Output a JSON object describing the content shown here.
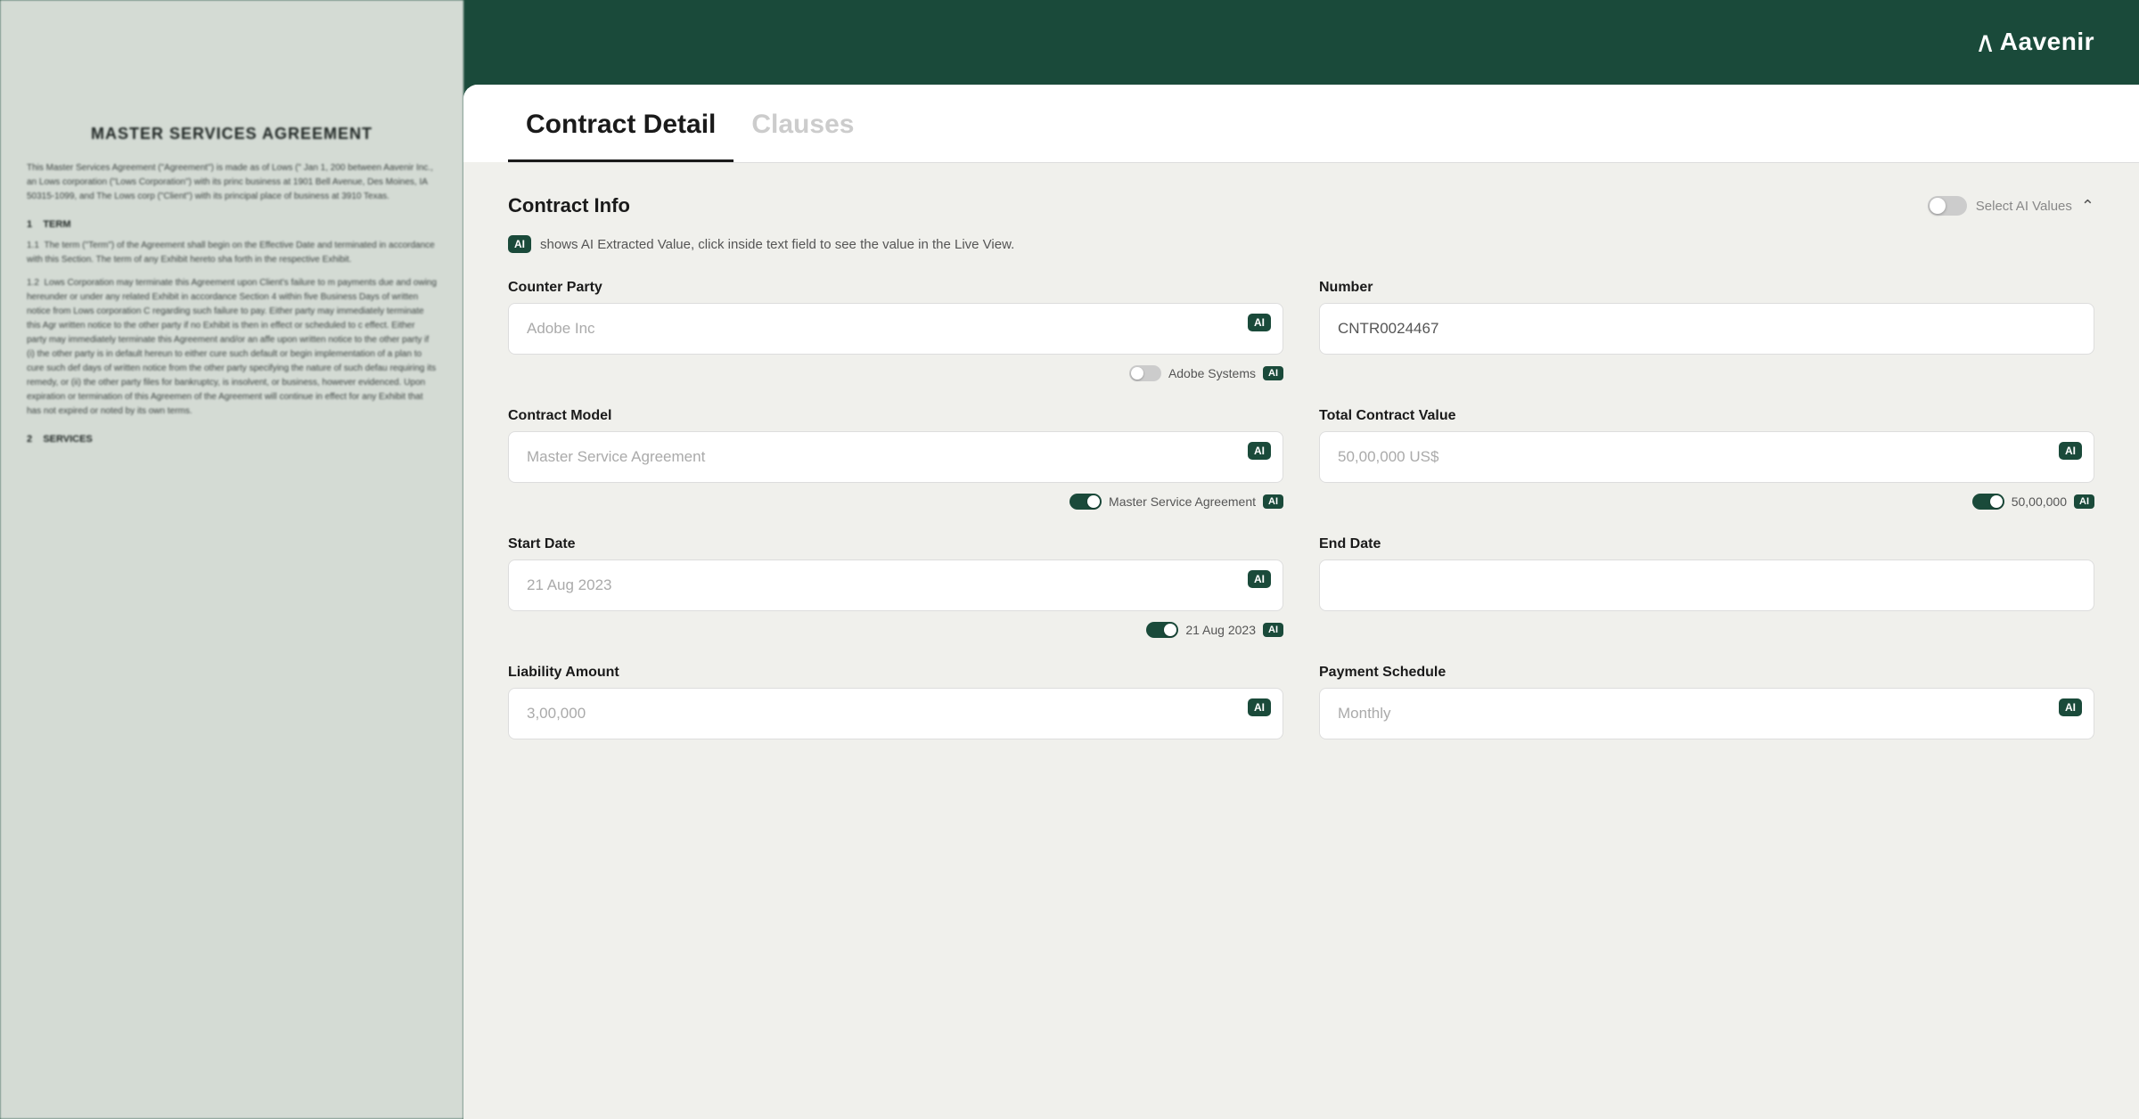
{
  "logo": {
    "name": "Aavenir",
    "icon": "∧"
  },
  "background_document": {
    "title": "MASTER SERVICES AGREEMENT",
    "paragraphs": [
      "This Master Services Agreement (\"Agreement\") is made as of Lows (\" Jan 1, 200 between Aavenir Inc., an Lows corporation (\"Lows Corporation\") with its princ business at 1901 Bell Avenue, Des Moines, IA 50315-1099, and The Lows corp (\"Client\") with its principal place of business at 3910 Texas.",
      "",
      "1    TERM",
      "",
      "1.1  The term (\"Term\") of the Agreement shall begin on the Effective Date and terminated in accordance with this Section. The term of any Exhibit hereto sha forth in the respective Exhibit.",
      "",
      "1.2  Lows Corporation may terminate this Agreement upon Client's failure to m payments due and owing hereunder or under any related Exhibit in accordance Section 4 within five Business Days of written notice from Lows corporation C regarding such failure to pay. Either party may immediately terminate this Agr written notice to the other party if no Exhibit is then in effect or scheduled to c effect. Either party may immediately terminate this Agreement and/or an affe upon written notice to the other party if (i) the other party is in default hereun to either cure such default or begin implementation of a plan to cure such def days of written notice from the other party specifying the nature of such defau requiring its remedy, or (ii) the other party files for bankruptcy, is insolvent, or business, however evidenced. Upon expiration or termination of this Agreemen of the Agreement will continue in effect for any Exhibit that has not expired or noted by its own terms.",
      "",
      "2    SERVICES"
    ]
  },
  "tabs": [
    {
      "label": "Contract Detail",
      "active": true
    },
    {
      "label": "Clauses",
      "active": false
    }
  ],
  "section": {
    "title": "Contract Info",
    "toggle_label": "Select AI Values",
    "ai_notice": "shows AI Extracted Value, click inside text field to see the value in the Live View."
  },
  "fields": {
    "counter_party": {
      "label": "Counter Party",
      "placeholder": "Adobe Inc",
      "has_ai_badge": true,
      "suggestion": {
        "text": "Adobe Systems",
        "has_ai": true,
        "active": false
      }
    },
    "number": {
      "label": "Number",
      "value": "CNTR0024467",
      "has_ai_badge": false,
      "suggestion": null
    },
    "contract_model": {
      "label": "Contract Model",
      "placeholder": "Master Service Agreement",
      "has_ai_badge": true,
      "suggestion": {
        "text": "Master Service Agreement",
        "has_ai": true,
        "active": true
      }
    },
    "total_contract_value": {
      "label": "Total Contract Value",
      "placeholder": "50,00,000 US$",
      "has_ai_badge": true,
      "suggestion": {
        "text": "50,00,000",
        "has_ai": true,
        "active": true
      }
    },
    "start_date": {
      "label": "Start Date",
      "placeholder": "21 Aug 2023",
      "has_ai_badge": true,
      "suggestion": {
        "text": "21 Aug 2023",
        "has_ai": true,
        "active": true
      }
    },
    "end_date": {
      "label": "End Date",
      "placeholder": "",
      "has_ai_badge": false,
      "suggestion": null
    },
    "liability_amount": {
      "label": "Liability Amount",
      "placeholder": "3,00,000",
      "has_ai_badge": true,
      "suggestion": null
    },
    "payment_schedule": {
      "label": "Payment Schedule",
      "placeholder": "Monthly",
      "has_ai_badge": true,
      "suggestion": null
    }
  }
}
